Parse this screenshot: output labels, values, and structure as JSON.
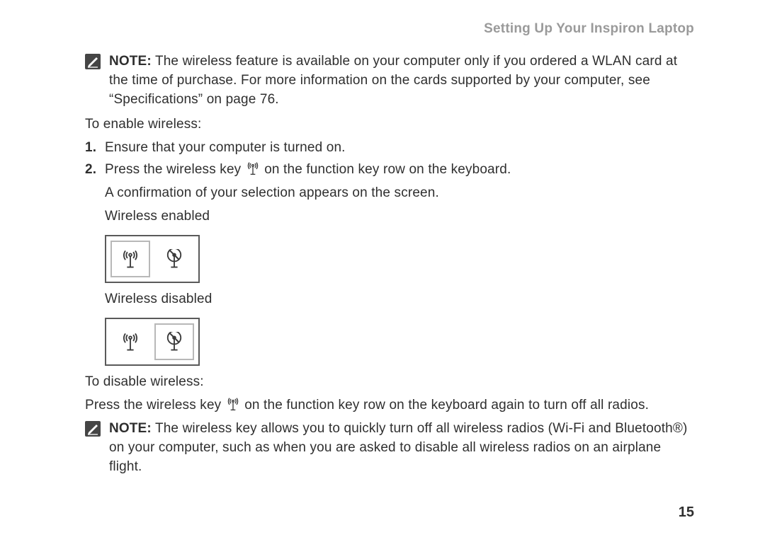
{
  "header": "Setting Up Your Inspiron Laptop",
  "note1": {
    "label": "NOTE:",
    "text": " The wireless feature is available on your computer only if you ordered a WLAN card at the time of purchase. For more information on the cards supported by your computer, see “Specifications” on page 76."
  },
  "enable_intro": "To enable wireless:",
  "step1": {
    "num": "1.",
    "text": "Ensure that your computer is turned on."
  },
  "step2": {
    "num": "2.",
    "pre": "Press the wireless key ",
    "post": " on the function key row on the keyboard."
  },
  "confirm": "A confirmation of your selection appears on the screen.",
  "enabled_label": "Wireless enabled",
  "disabled_label": "Wireless disabled",
  "disable_intro": "To disable wireless:",
  "disable_line": {
    "pre": "Press the wireless key ",
    "post": " on the function key row on the keyboard again to turn off all radios."
  },
  "note2": {
    "label": "NOTE:",
    "text": " The wireless key allows you to quickly turn off all wireless radios (Wi-Fi and Bluetooth®) on your computer, such as when you are asked to disable all wireless radios on an airplane flight."
  },
  "page_number": "15"
}
